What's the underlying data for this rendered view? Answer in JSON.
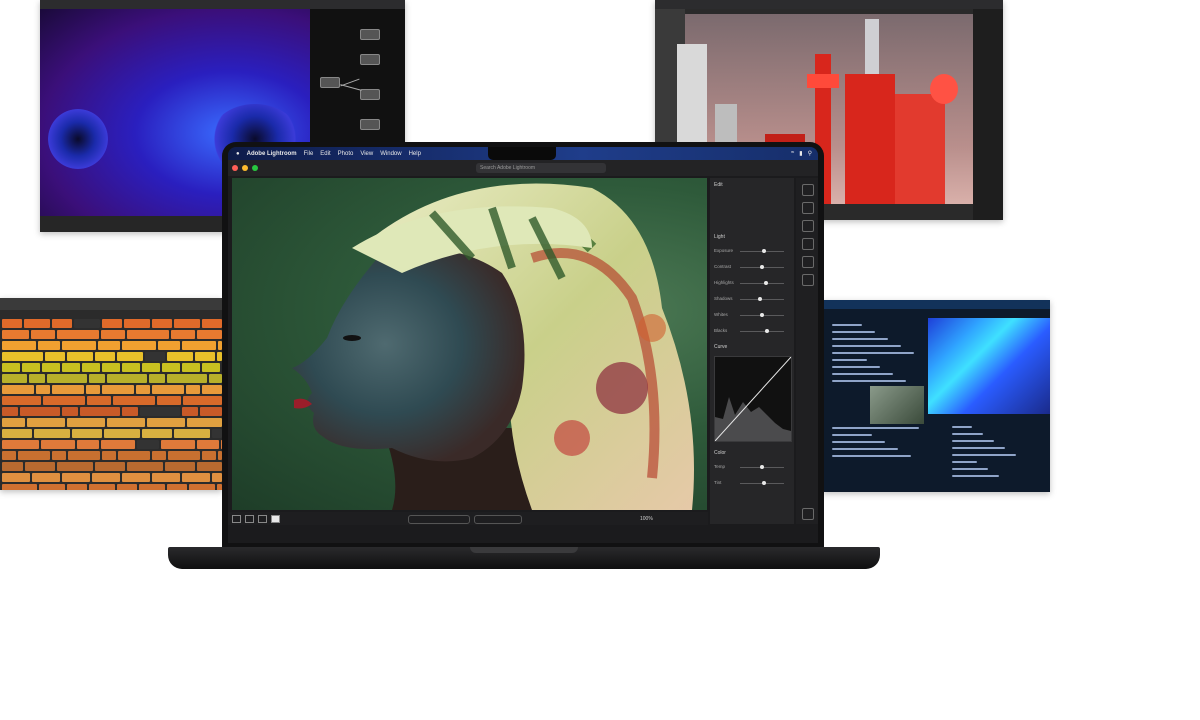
{
  "laptop": {
    "menubar": {
      "items": [
        "Adobe Lightroom",
        "File",
        "Edit",
        "Photo",
        "View",
        "Window",
        "Help"
      ]
    },
    "toolbar": {
      "search_placeholder": "Search Adobe Lightroom"
    },
    "side_panel": {
      "edit_title": "Edit",
      "light_section": "Light",
      "sliders": [
        {
          "label": "Exposure",
          "value": 0.55
        },
        {
          "label": "Contrast",
          "value": 0.5
        },
        {
          "label": "Highlights",
          "value": 0.6
        },
        {
          "label": "Shadows",
          "value": 0.45
        },
        {
          "label": "Whites",
          "value": 0.5
        },
        {
          "label": "Blacks",
          "value": 0.62
        }
      ],
      "curve_section": "Curve",
      "color_section": "Color",
      "color_sliders": [
        {
          "label": "Temp",
          "value": 0.5
        },
        {
          "label": "Tint",
          "value": 0.55
        }
      ]
    },
    "bottombar": {
      "zoom": "100%"
    }
  },
  "colors": {
    "red": "#d8261c",
    "traffic_close": "#ff5f57",
    "traffic_min": "#febc2e",
    "traffic_max": "#28c840"
  }
}
